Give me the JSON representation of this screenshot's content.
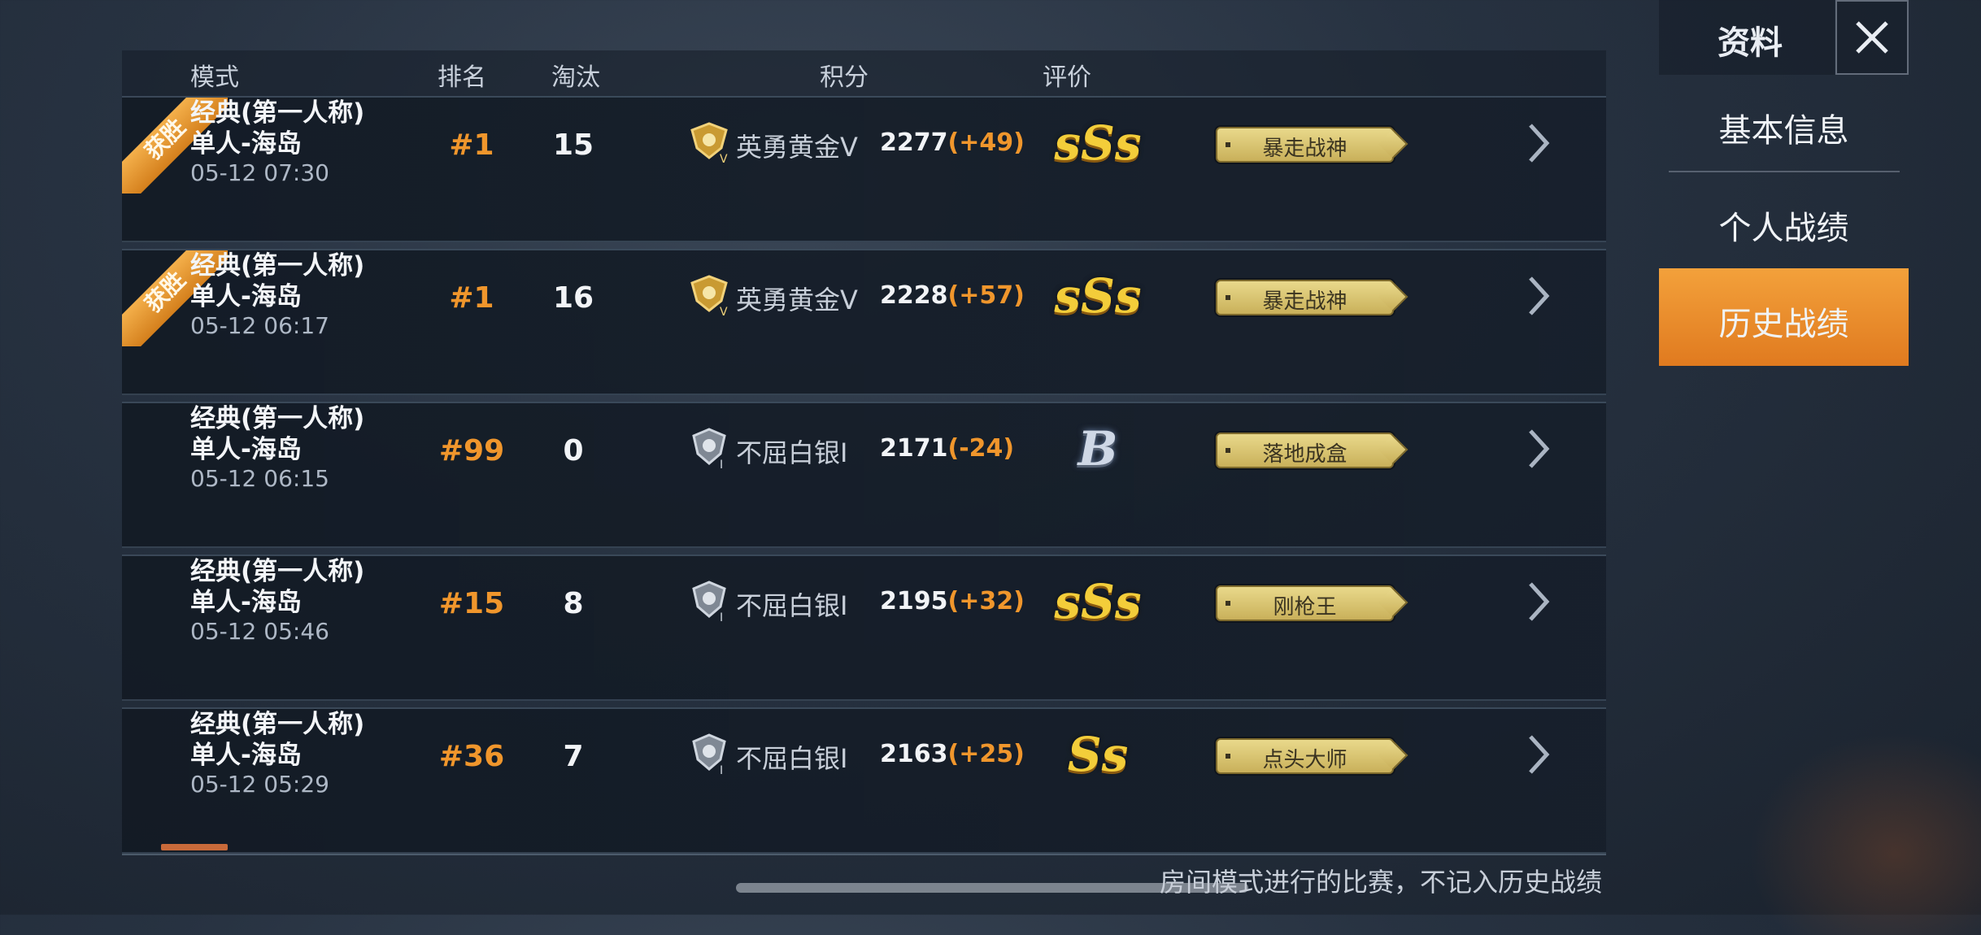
{
  "header": {
    "mode": "模式",
    "rank": "排名",
    "elims": "淘汰",
    "score": "积分",
    "grade": "评价"
  },
  "rows": [
    {
      "win_label": "获胜",
      "mode": "经典(第一人称)",
      "map": "单人-海岛",
      "time": "05-12 07:30",
      "rank": "#1",
      "elims": "15",
      "tier": "英勇黄金Ⅴ",
      "tier_icon": "gold-tier-icon",
      "score": "2277",
      "delta": "(+49)",
      "grade": "sSs",
      "title": "暴走战神"
    },
    {
      "win_label": "获胜",
      "mode": "经典(第一人称)",
      "map": "单人-海岛",
      "time": "05-12 06:17",
      "rank": "#1",
      "elims": "16",
      "tier": "英勇黄金Ⅴ",
      "tier_icon": "gold-tier-icon",
      "score": "2228",
      "delta": "(+57)",
      "grade": "sSs",
      "title": "暴走战神"
    },
    {
      "mode": "经典(第一人称)",
      "map": "单人-海岛",
      "time": "05-12 06:15",
      "rank": "#99",
      "elims": "0",
      "tier": "不屈白银Ⅰ",
      "tier_icon": "silver-tier-icon",
      "score": "2171",
      "delta": "(-24)",
      "grade": "B",
      "title": "落地成盒"
    },
    {
      "mode": "经典(第一人称)",
      "map": "单人-海岛",
      "time": "05-12 05:46",
      "rank": "#15",
      "elims": "8",
      "tier": "不屈白银Ⅰ",
      "tier_icon": "silver-tier-icon",
      "score": "2195",
      "delta": "(+32)",
      "grade": "sSs",
      "title": "刚枪王"
    },
    {
      "mode": "经典(第一人称)",
      "map": "单人-海岛",
      "time": "05-12 05:29",
      "rank": "#36",
      "elims": "7",
      "tier": "不屈白银Ⅰ",
      "tier_icon": "silver-tier-icon",
      "score": "2163",
      "delta": "(+25)",
      "grade": "Ss",
      "title": "点头大师"
    }
  ],
  "footer_note": "房间模式进行的比赛，不记入历史战绩",
  "sidebar": {
    "title": "资料",
    "items": [
      {
        "label": "基本信息",
        "active": false
      },
      {
        "label": "个人战绩",
        "active": false
      },
      {
        "label": "历史战绩",
        "active": true
      }
    ]
  },
  "colors": {
    "accent": "#f0962c",
    "gold": "#f3cd3a",
    "active_tab": "#e88a2a"
  }
}
